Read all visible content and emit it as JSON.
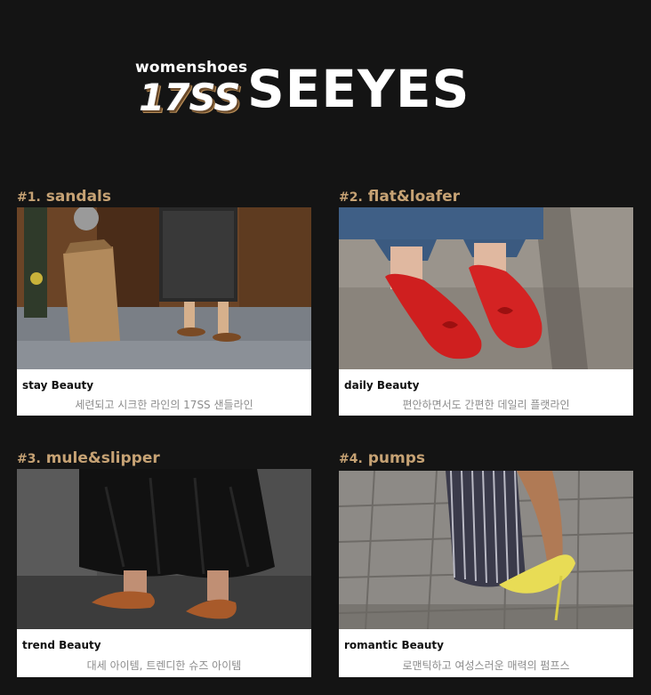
{
  "brand": {
    "subtitle": "womenshoes",
    "number": "17SS",
    "name": "SEEYES"
  },
  "sections": [
    {
      "number": "#1.",
      "title": "sandals",
      "caption_title": "stay Beauty",
      "caption_desc": "세련되고 시크한 라인의 17SS 샌들라인"
    },
    {
      "number": "#2.",
      "title": "flat&loafer",
      "caption_title": "daily Beauty",
      "caption_desc": "편안하면서도 간편한 데일리 플랫라인"
    },
    {
      "number": "#3.",
      "title": "mule&slipper",
      "caption_title": "trend Beauty",
      "caption_desc": "대세 아이템, 트렌디한 슈즈 아이템"
    },
    {
      "number": "#4.",
      "title": "pumps",
      "caption_title": "romantic Beauty",
      "caption_desc": "로맨틱하고 여성스러운 매력의 펌프스"
    }
  ],
  "colors": {
    "background": "#141414",
    "accent": "#c6a274"
  }
}
